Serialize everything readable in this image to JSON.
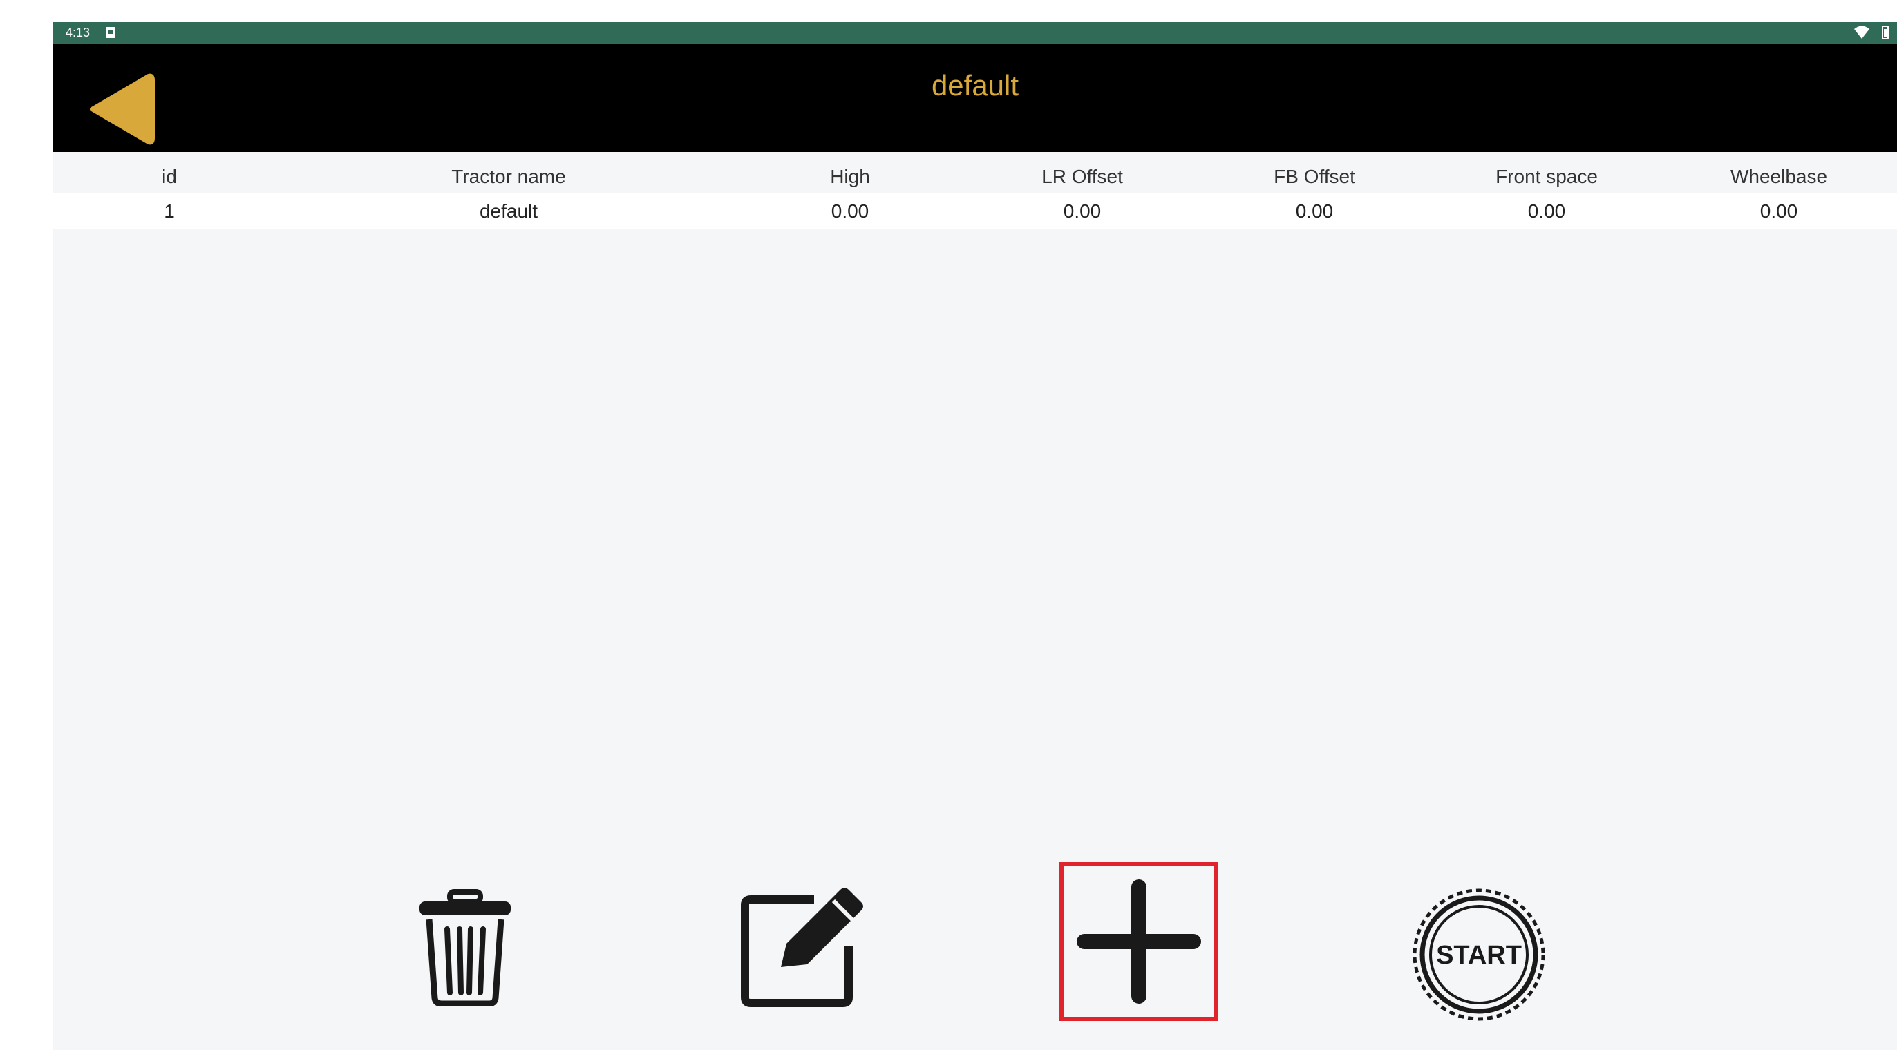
{
  "status_bar": {
    "time": "4:13",
    "notification_icon": "notification-icon",
    "wifi_icon": "wifi-icon",
    "battery_icon": "battery-icon",
    "background_color": "#2f6b57"
  },
  "app_bar": {
    "title": "default",
    "title_color": "#d9a83a",
    "back_icon": "back-arrow-icon",
    "back_icon_color": "#d9a83a",
    "background_color": "#000000"
  },
  "table": {
    "columns": [
      "id",
      "Tractor name",
      "High",
      "LR Offset",
      "FB Offset",
      "Front space",
      "Wheelbase"
    ],
    "rows": [
      [
        "1",
        "default",
        "0.00",
        "0.00",
        "0.00",
        "0.00",
        "0.00"
      ]
    ]
  },
  "toolbar": {
    "delete_icon": "trash-icon",
    "edit_icon": "edit-icon",
    "add_icon": "plus-icon",
    "start_label": "START",
    "highlight_color": "#e0242c"
  }
}
